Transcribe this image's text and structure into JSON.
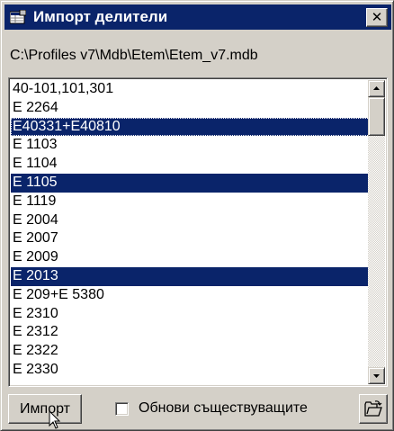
{
  "window": {
    "title": "Импорт делители",
    "close_label": "✕",
    "title_icon": "database-table-icon",
    "titlebar_color": "#0a246a"
  },
  "path_label": "C:\\Profiles v7\\Mdb\\Etem\\Etem_v7.mdb",
  "list": {
    "selection_color": "#0a246a",
    "items": [
      {
        "label": "40-101,101,301",
        "selected": false,
        "focused": false
      },
      {
        "label": "E 2264",
        "selected": false,
        "focused": false
      },
      {
        "label": "E40331+E40810",
        "selected": true,
        "focused": true
      },
      {
        "label": "E 1103",
        "selected": false,
        "focused": false
      },
      {
        "label": "E 1104",
        "selected": false,
        "focused": false
      },
      {
        "label": "E 1105",
        "selected": true,
        "focused": false
      },
      {
        "label": "E 1119",
        "selected": false,
        "focused": false
      },
      {
        "label": "E 2004",
        "selected": false,
        "focused": false
      },
      {
        "label": "E 2007",
        "selected": false,
        "focused": false
      },
      {
        "label": "E 2009",
        "selected": false,
        "focused": false
      },
      {
        "label": "E 2013",
        "selected": true,
        "focused": false
      },
      {
        "label": "E 209+E 5380",
        "selected": false,
        "focused": false
      },
      {
        "label": "E 2310",
        "selected": false,
        "focused": false
      },
      {
        "label": "E 2312",
        "selected": false,
        "focused": false
      },
      {
        "label": "E 2322",
        "selected": false,
        "focused": false
      },
      {
        "label": "E 2330",
        "selected": false,
        "focused": false
      }
    ]
  },
  "scrollbar": {
    "up_icon": "arrow-up-icon",
    "down_icon": "arrow-down-icon",
    "position": 0
  },
  "footer": {
    "import_label": "Импорт",
    "checkbox_label": "Обнови съществуващите",
    "checkbox_checked": false,
    "open_icon": "open-folder-icon"
  }
}
